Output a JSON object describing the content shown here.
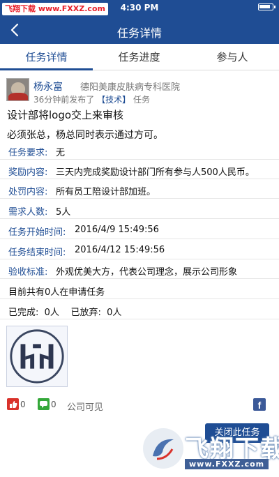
{
  "status_bar": {
    "time": "4:30 PM"
  },
  "watermark_top": "飞翔下载 www.FXXZ.com",
  "navbar": {
    "title": "任务详情"
  },
  "tabs": [
    {
      "label": "任务详情",
      "active": true
    },
    {
      "label": "任务进度",
      "active": false
    },
    {
      "label": "参与人",
      "active": false
    }
  ],
  "post": {
    "author": "杨永富",
    "organization": "德阳美康皮肤病专科医院",
    "time_ago": "36分钟前发布了",
    "category_tag": "【技术】",
    "type": "任务",
    "title": "设计部将logo交上来审核",
    "description": "必须张总，杨总同时表示通过方可。"
  },
  "fields": [
    {
      "label": "任务要求:",
      "value": "无"
    },
    {
      "label": "奖励内容:",
      "value": "三天内完成奖励设计部门所有参与人500人民币。"
    },
    {
      "label": "处罚内容:",
      "value": "所有员工陪设计部加班。"
    },
    {
      "label": "需求人数:",
      "value": "5人"
    },
    {
      "label": "任务开始时间:",
      "value": "2016/4/9 15:49:56"
    },
    {
      "label": "任务结束时间:",
      "value": "2016/4/12 15:49:56"
    },
    {
      "label": "验收标准:",
      "value": "外观优美大方，代表公司理念，展示公司形象"
    }
  ],
  "applicants_text": "目前共有0人在申请任务",
  "progress": {
    "done_label": "已完成:",
    "done_value": "0人",
    "abandon_label": "已放弃:",
    "abandon_value": "0人"
  },
  "footer": {
    "likes": "0",
    "comments": "0",
    "visibility": "公司可见",
    "share": "f"
  },
  "button": {
    "label": "关闭此任务"
  },
  "watermark_bottom": {
    "big": "飞翔下载",
    "url": "www.FXXZ.com"
  },
  "colors": {
    "primary": "#1f4d94",
    "like": "#d9322b",
    "comment": "#35a83a",
    "facebook": "#3b5998"
  }
}
